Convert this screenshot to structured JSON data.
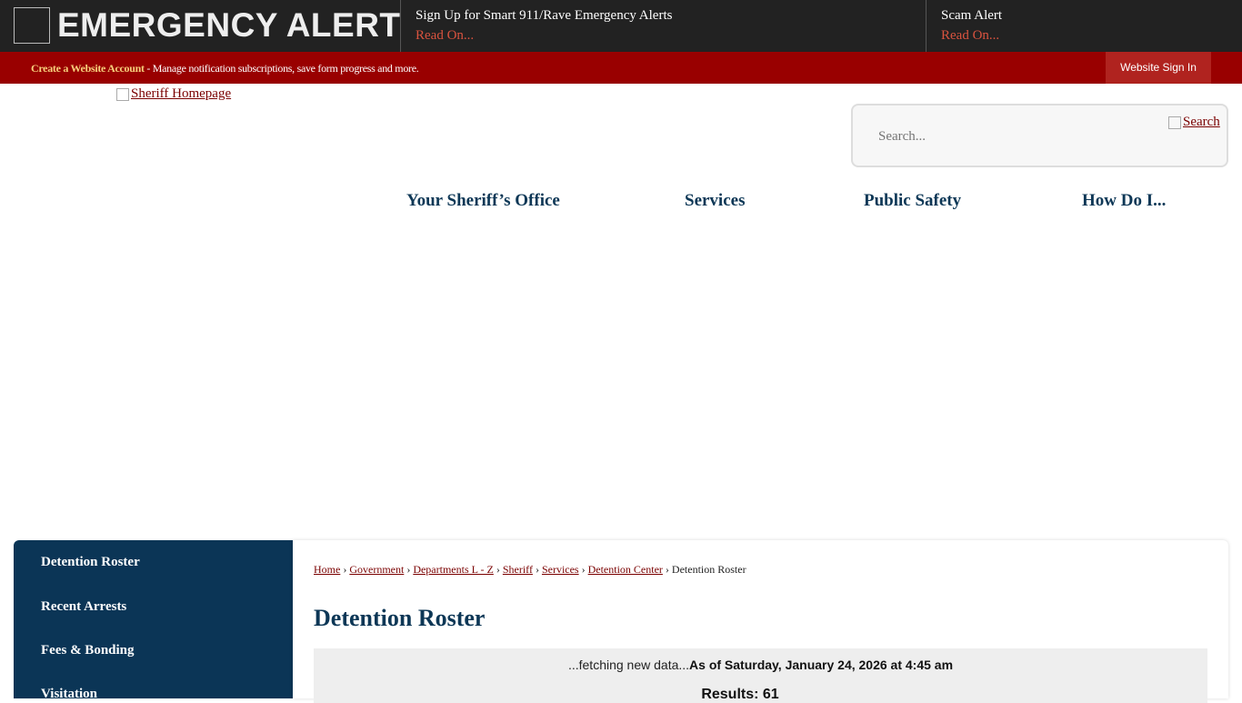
{
  "alert_bar": {
    "title": "EMERGENCY ALERT",
    "items": [
      {
        "title": "Sign Up for Smart 911/Rave Emergency Alerts",
        "link": "Read On..."
      },
      {
        "title": "Scam Alert",
        "link": "Read On..."
      }
    ]
  },
  "account_bar": {
    "create_link": "Create a Website Account",
    "description": " - Manage notification subscriptions, save form progress and more.",
    "sign_in": "Website Sign In"
  },
  "header": {
    "logo_alt": "Sheriff Homepage",
    "search_placeholder": "Search...",
    "search_button": "Search",
    "nav": [
      "Your Sheriff’s Office",
      "Services",
      "Public Safety",
      "How Do I..."
    ]
  },
  "side_nav": {
    "items": [
      "Detention Roster",
      "Recent Arrests",
      "Fees & Bonding",
      "Visitation"
    ]
  },
  "breadcrumb": {
    "links": [
      "Home",
      "Government",
      "Departments L - Z",
      "Sheriff",
      "Services",
      "Detention Center"
    ],
    "current": "Detention Roster",
    "separator": "›"
  },
  "main": {
    "title": "Detention Roster",
    "fetching": "...fetching new data...",
    "as_of": "As of Saturday, January 24, 2026 at 4:45 am",
    "results": "Results: 61"
  },
  "colors": {
    "alert_bg": "#222222",
    "account_bar": "#990000",
    "navy": "#0d3756",
    "link": "#7a0000"
  }
}
